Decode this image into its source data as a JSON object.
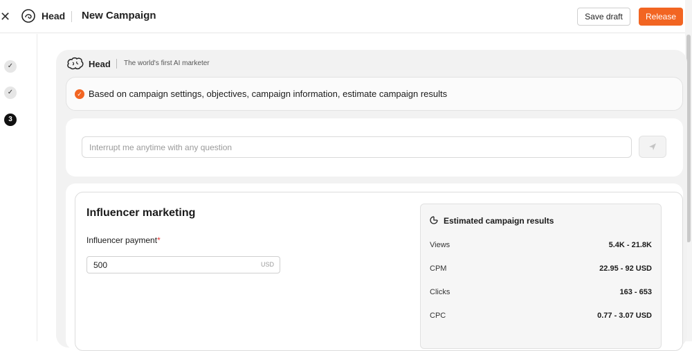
{
  "header": {
    "brand": "Head",
    "title": "New Campaign",
    "save_draft_label": "Save draft",
    "release_label": "Release",
    "accent_color": "#f26522"
  },
  "steps": [
    {
      "state": "done",
      "label": "✓"
    },
    {
      "state": "done",
      "label": "✓"
    },
    {
      "state": "current",
      "label": "3"
    }
  ],
  "assistant": {
    "brand": "Head",
    "tagline": "The world's first AI marketer",
    "status_text": "Based on campaign settings, objectives, campaign information, estimate campaign results",
    "input_placeholder": "Interrupt me anytime with any question"
  },
  "form": {
    "section_title": "Influencer marketing",
    "payment_label": "Influencer payment",
    "required_mark": "*",
    "payment_value": "500",
    "payment_unit": "USD"
  },
  "results": {
    "title": "Estimated campaign results",
    "metrics": [
      {
        "name": "Views",
        "value": "5.4K - 21.8K"
      },
      {
        "name": "CPM",
        "value": "22.95 - 92 USD"
      },
      {
        "name": "Clicks",
        "value": "163 - 653"
      },
      {
        "name": "CPC",
        "value": "0.77 - 3.07 USD"
      }
    ]
  }
}
